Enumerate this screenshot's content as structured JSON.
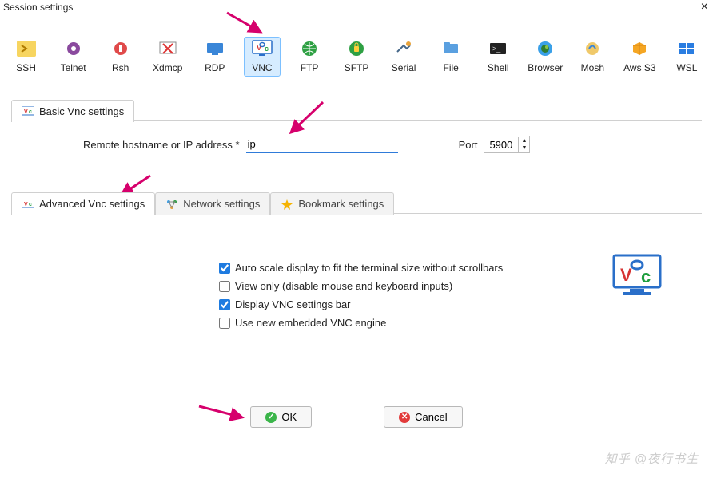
{
  "window": {
    "title": "Session settings"
  },
  "protocols": [
    {
      "id": "ssh",
      "label": "SSH"
    },
    {
      "id": "telnet",
      "label": "Telnet"
    },
    {
      "id": "rsh",
      "label": "Rsh"
    },
    {
      "id": "xdmcp",
      "label": "Xdmcp"
    },
    {
      "id": "rdp",
      "label": "RDP"
    },
    {
      "id": "vnc",
      "label": "VNC",
      "selected": true
    },
    {
      "id": "ftp",
      "label": "FTP"
    },
    {
      "id": "sftp",
      "label": "SFTP"
    },
    {
      "id": "serial",
      "label": "Serial"
    },
    {
      "id": "file",
      "label": "File"
    },
    {
      "id": "shell",
      "label": "Shell"
    },
    {
      "id": "browser",
      "label": "Browser"
    },
    {
      "id": "mosh",
      "label": "Mosh"
    },
    {
      "id": "awss3",
      "label": "Aws S3"
    },
    {
      "id": "wsl",
      "label": "WSL"
    }
  ],
  "basic": {
    "tab_label": "Basic Vnc settings",
    "host_label": "Remote hostname or IP address *",
    "host_value": "ip",
    "port_label": "Port",
    "port_value": "5900"
  },
  "adv_tabs": {
    "advanced": "Advanced Vnc settings",
    "network": "Network settings",
    "bookmark": "Bookmark settings"
  },
  "adv_opts": {
    "autoscale": {
      "label": "Auto scale display to fit the terminal size without scrollbars",
      "checked": true
    },
    "viewonly": {
      "label": "View only (disable mouse and keyboard inputs)",
      "checked": false
    },
    "settingsbar": {
      "label": "Display VNC settings bar",
      "checked": true
    },
    "newengine": {
      "label": "Use new embedded VNC engine",
      "checked": false
    }
  },
  "buttons": {
    "ok": "OK",
    "cancel": "Cancel"
  },
  "watermark": "知乎 @夜行书生"
}
